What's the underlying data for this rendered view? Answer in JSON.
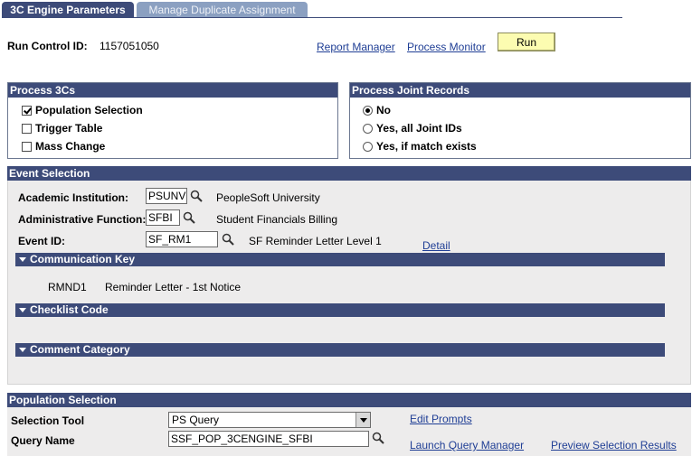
{
  "tabs": [
    {
      "label": "3C Engine Parameters"
    },
    {
      "label": "Manage Duplicate Assignment"
    }
  ],
  "header": {
    "run_control_label": "Run Control ID:",
    "run_control_value": "1157051050",
    "report_manager": "Report Manager",
    "process_monitor": "Process Monitor",
    "run_button": "Run"
  },
  "process_3cs": {
    "title": "Process 3Cs",
    "options": [
      {
        "label": "Population Selection",
        "checked": true
      },
      {
        "label": "Trigger Table",
        "checked": false
      },
      {
        "label": "Mass Change",
        "checked": false
      }
    ]
  },
  "process_joint": {
    "title": "Process Joint Records",
    "options": [
      {
        "label": "No",
        "checked": true
      },
      {
        "label": "Yes, all Joint IDs",
        "checked": false
      },
      {
        "label": "Yes, if match exists",
        "checked": false
      }
    ]
  },
  "event_selection": {
    "title": "Event Selection",
    "institution_label": "Academic Institution:",
    "institution_value": "PSUNV",
    "institution_desc": "PeopleSoft University",
    "admin_function_label": "Administrative Function:",
    "admin_function_value": "SFBI",
    "admin_function_desc": "Student Financials Billing",
    "event_id_label": "Event ID:",
    "event_id_value": "SF_RM1",
    "event_id_desc": "SF Reminder Letter Level 1",
    "detail_link": "Detail",
    "comm_key_title": "Communication Key",
    "comm_key_code": "RMND1",
    "comm_key_desc": "Reminder Letter - 1st Notice",
    "checklist_title": "Checklist Code",
    "comment_title": "Comment Category"
  },
  "population_selection": {
    "title": "Population Selection",
    "selection_tool_label": "Selection Tool",
    "selection_tool_value": "PS Query",
    "query_name_label": "Query Name",
    "query_name_value": "SSF_POP_3CENGINE_SFBI",
    "edit_prompts": "Edit Prompts",
    "launch_query_manager": "Launch Query Manager",
    "preview_selection": "Preview Selection Results"
  },
  "colors": {
    "header_navy": "#3d4b79",
    "inactive_tab": "#8ba0c1",
    "run_button_bg": "#fcfcb1",
    "link_blue": "#1f3e95",
    "panel_gray": "#edecec"
  }
}
